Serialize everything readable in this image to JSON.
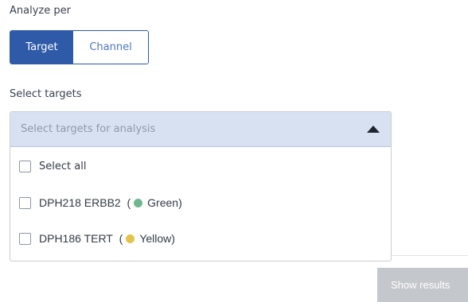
{
  "analyze": {
    "label": "Analyze per",
    "options": [
      "Target",
      "Channel"
    ],
    "selected": "Target"
  },
  "targets": {
    "label": "Select targets",
    "placeholder": "Select targets for analysis",
    "select_all": "Select all",
    "items": [
      {
        "name": "DPH218 ERBB2",
        "channel": "Green",
        "color": "#6fb88f",
        "checked": false
      },
      {
        "name": "DPH186 TERT",
        "channel": "Yellow",
        "color": "#e2c34c",
        "checked": false
      }
    ]
  },
  "actions": {
    "show_results": "Show results",
    "show_results_enabled": false
  },
  "colors": {
    "accent": "#2f5aa8",
    "dropdown_head": "#d7e1f2",
    "disabled_button": "#c4c7cc"
  }
}
